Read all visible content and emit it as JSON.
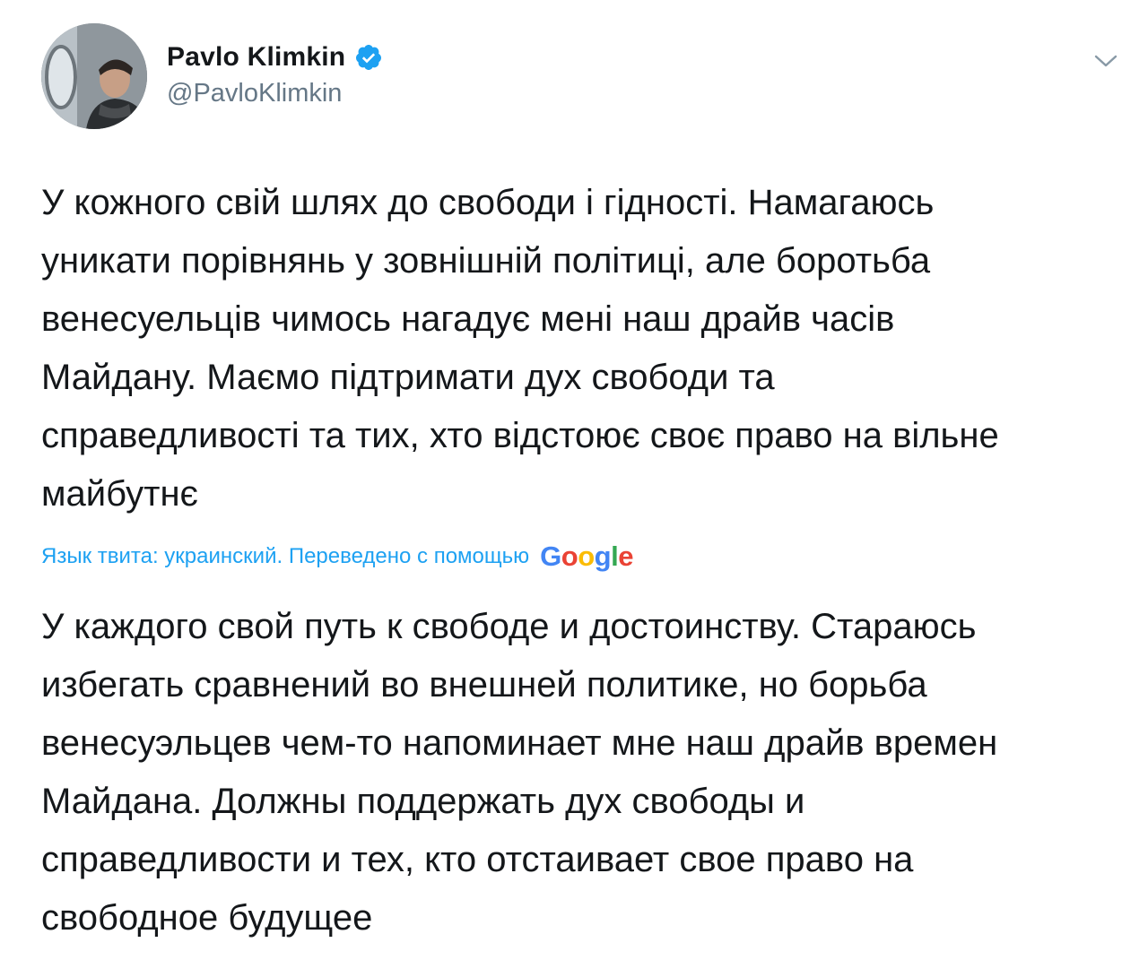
{
  "tweet": {
    "author": {
      "display_name": "Pavlo Klimkin",
      "handle": "@PavloKlimkin",
      "verified": true
    },
    "original_text": "У кожного свій шлях до свободи і гідності. Намагаюсь\nуникати порівнянь у зовнішній політиці, але боротьба\nвенесуельців чимось нагадує мені наш драйв часів\nМайдану. Маємо підтримати дух свободи та\nсправедливості та тих, хто відстоює своє право на вільне\nмайбутнє",
    "translation_note": "Язык твита: украинский. Переведено с помощью",
    "translation_logo": "Google",
    "translated_text": "У каждого свой путь к свободе и достоинству. Стараюсь\nизбегать сравнений во внешней политике, но борьба\nвенесуэльцев чем-то напоминает мне наш драйв времен\nМайдана. Должны поддержать дух свободы и\nсправедливости и тех, кто отстаивает свое право на\nсвободное будущее"
  },
  "icons": {
    "verified": "verified-badge-icon",
    "menu": "chevron-down-icon"
  },
  "colors": {
    "link_blue": "#1da1f2",
    "handle_gray": "#657786",
    "text": "#14171a",
    "google_blue": "#4285f4",
    "google_red": "#ea4335",
    "google_yellow": "#fbbc05",
    "google_green": "#34a853"
  }
}
